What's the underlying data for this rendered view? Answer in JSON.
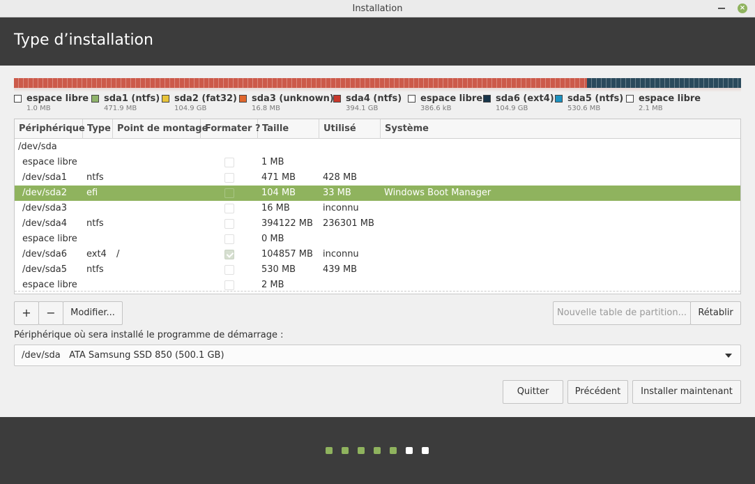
{
  "window": {
    "title": "Installation"
  },
  "header": {
    "title": "Type d’installation"
  },
  "diskbar": [
    {
      "color": "#cc5a4a",
      "fraction": 0.7885
    },
    {
      "color": "#2b4a5c",
      "fraction": 0.2115
    }
  ],
  "legend": [
    {
      "name": "espace libre",
      "size": "1.0 MB",
      "color": "#ffffff"
    },
    {
      "name": "sda1 (ntfs)",
      "size": "471.9 MB",
      "color": "#8fb36b"
    },
    {
      "name": "sda2 (fat32)",
      "size": "104.9 GB",
      "color": "#e8c43a"
    },
    {
      "name": "sda3 (unknown)",
      "size": "16.8 MB",
      "color": "#e0662d"
    },
    {
      "name": "sda4 (ntfs)",
      "size": "394.1 GB",
      "color": "#c8382c"
    },
    {
      "name": "espace libre",
      "size": "386.6 kB",
      "color": "#ffffff"
    },
    {
      "name": "sda6 (ext4)",
      "size": "104.9 GB",
      "color": "#18354a"
    },
    {
      "name": "sda5 (ntfs)",
      "size": "530.6 MB",
      "color": "#1d92c0"
    },
    {
      "name": "espace libre",
      "size": "2.1 MB",
      "color": "#ffffff"
    }
  ],
  "table": {
    "columns": [
      "Périphérique",
      "Type",
      "Point de montage",
      "Formater ?",
      "Taille",
      "Utilisé",
      "Système"
    ],
    "rows": [
      {
        "device": "/dev/sda",
        "type": "",
        "mount": "",
        "format": null,
        "size": "",
        "used": "",
        "system": ""
      },
      {
        "device": "espace libre",
        "type": "",
        "mount": "",
        "format": false,
        "size": "1 MB",
        "used": "",
        "system": ""
      },
      {
        "device": "/dev/sda1",
        "type": "ntfs",
        "mount": "",
        "format": false,
        "size": "471 MB",
        "used": "428 MB",
        "system": ""
      },
      {
        "device": "/dev/sda2",
        "type": "efi",
        "mount": "",
        "format": false,
        "size": "104 MB",
        "used": "33 MB",
        "system": "Windows Boot Manager",
        "selected": true
      },
      {
        "device": "/dev/sda3",
        "type": "",
        "mount": "",
        "format": false,
        "size": "16 MB",
        "used": "inconnu",
        "system": ""
      },
      {
        "device": "/dev/sda4",
        "type": "ntfs",
        "mount": "",
        "format": false,
        "size": "394122 MB",
        "used": "236301 MB",
        "system": ""
      },
      {
        "device": "espace libre",
        "type": "",
        "mount": "",
        "format": false,
        "size": "0 MB",
        "used": "",
        "system": ""
      },
      {
        "device": "/dev/sda6",
        "type": "ext4",
        "mount": "/",
        "format": true,
        "size": "104857 MB",
        "used": "inconnu",
        "system": ""
      },
      {
        "device": "/dev/sda5",
        "type": "ntfs",
        "mount": "",
        "format": false,
        "size": "530 MB",
        "used": "439 MB",
        "system": ""
      },
      {
        "device": "espace libre",
        "type": "",
        "mount": "",
        "format": false,
        "size": "2 MB",
        "used": "",
        "system": ""
      }
    ]
  },
  "toolbar": {
    "add_label": "+",
    "remove_label": "−",
    "modify_label": "Modifier...",
    "new_table_label": "Nouvelle table de partition...",
    "revert_label": "Rétablir"
  },
  "bootloader": {
    "label": "Périphérique où sera installé le programme de démarrage :",
    "value": "/dev/sda   ATA Samsung SSD 850 (500.1 GB)"
  },
  "actions": {
    "quit_label": "Quitter",
    "back_label": "Précédent",
    "install_label": "Installer maintenant"
  },
  "progress": {
    "steps_total": 7,
    "steps_completed": 5,
    "completed_color": "#8fb35e",
    "pending_color": "#ffffff"
  }
}
